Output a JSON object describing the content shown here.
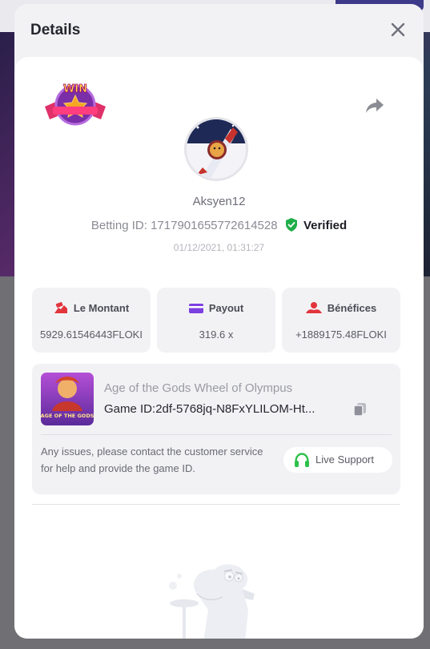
{
  "modal": {
    "title": "Details"
  },
  "bet": {
    "username": "Aksyen12",
    "betting_id_label": "Betting ID:",
    "betting_id": "1717901655772614528",
    "verified_label": "Verified",
    "timestamp": "01/12/2021, 01:31:27"
  },
  "stats": [
    {
      "label": "Le Montant",
      "value": "5929.61546443FLOKI",
      "icon": "amount-icon"
    },
    {
      "label": "Payout",
      "value": "319.6 x",
      "icon": "payout-card-icon"
    },
    {
      "label": "Bénéfices",
      "value": "+1889175.48FLOKI",
      "icon": "profit-icon"
    }
  ],
  "game": {
    "name": "Age of the Gods Wheel of Olympus",
    "id_label": "Game ID:",
    "id_value": "2df-5768jq-N8FxYLILOM-Ht...",
    "thumb_text": "AGE OF THE GODS"
  },
  "support": {
    "issues_text": "Any issues, please contact the customer service for help and provide the game ID.",
    "button_label": "Live Support"
  },
  "badge": {
    "text": "WIN"
  },
  "colors": {
    "accent_purple": "#6b4ce0",
    "verified_green": "#1fae4a",
    "support_green": "#2ec14a",
    "profit_red": "#e2343c"
  }
}
